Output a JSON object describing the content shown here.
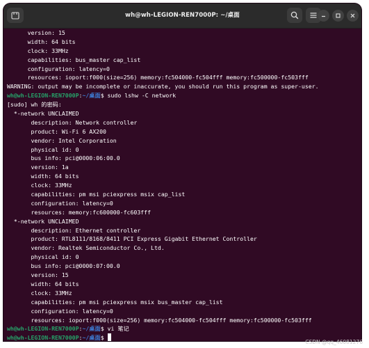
{
  "window": {
    "title": "wh@wh-LEGION-REN7000P: ~/桌面",
    "icons": [
      "new-tab-icon",
      "search-icon",
      "menu-icon",
      "minimize-icon",
      "maximize-icon",
      "close-icon"
    ]
  },
  "terminal": {
    "colors": {
      "background": "#300a24",
      "text": "#ffffff",
      "user": "#26a269",
      "path": "#3d7dd6"
    },
    "lines": [
      {
        "text": "      version: 15"
      },
      {
        "text": "      width: 64 bits"
      },
      {
        "text": "      clock: 33MHz"
      },
      {
        "text": "      capabilities: bus_master cap_list"
      },
      {
        "text": "      configuration: latency=0"
      },
      {
        "text": "      resources: ioport:f000(size=256) memory:fc504000-fc504fff memory:fc500000-fc503fff"
      },
      {
        "text": "WARNING: output may be incomplete or inaccurate, you should run this program as super-user."
      },
      {
        "prompt_user": "wh@wh-LEGION-REN7000P",
        "prompt_sep": ":",
        "prompt_path": "~/桌面",
        "prompt_end": "$ ",
        "command": "sudo lshw -C network"
      },
      {
        "text": "[sudo] wh 的密码:"
      },
      {
        "text": "  *-network UNCLAIMED"
      },
      {
        "text": "       description: Network controller"
      },
      {
        "text": "       product: Wi-Fi 6 AX200"
      },
      {
        "text": "       vendor: Intel Corporation"
      },
      {
        "text": "       physical id: 0"
      },
      {
        "text": "       bus info: pci@0000:06:00.0"
      },
      {
        "text": "       version: 1a"
      },
      {
        "text": "       width: 64 bits"
      },
      {
        "text": "       clock: 33MHz"
      },
      {
        "text": "       capabilities: pm msi pciexpress msix cap_list"
      },
      {
        "text": "       configuration: latency=0"
      },
      {
        "text": "       resources: memory:fc600000-fc603fff"
      },
      {
        "text": "  *-network UNCLAIMED"
      },
      {
        "text": "       description: Ethernet controller"
      },
      {
        "text": "       product: RTL8111/8168/8411 PCI Express Gigabit Ethernet Controller"
      },
      {
        "text": "       vendor: Realtek Semiconductor Co., Ltd."
      },
      {
        "text": "       physical id: 0"
      },
      {
        "text": "       bus info: pci@0000:07:00.0"
      },
      {
        "text": "       version: 15"
      },
      {
        "text": "       width: 64 bits"
      },
      {
        "text": "       clock: 33MHz"
      },
      {
        "text": "       capabilities: pm msi pciexpress msix bus_master cap_list"
      },
      {
        "text": "       configuration: latency=0"
      },
      {
        "text": "       resources: ioport:f000(size=256) memory:fc504000-fc504fff memory:fc500000-fc503fff"
      },
      {
        "prompt_user": "wh@wh-LEGION-REN7000P",
        "prompt_sep": ":",
        "prompt_path": "~/桌面",
        "prompt_end": "$ ",
        "command": "vi 笔记"
      },
      {
        "prompt_user": "wh@wh-LEGION-REN7000P",
        "prompt_sep": ":",
        "prompt_path": "~/桌面",
        "prompt_end": "$ ",
        "command": "",
        "cursor": true
      }
    ]
  },
  "watermark": "CSDN @qq_46081276"
}
